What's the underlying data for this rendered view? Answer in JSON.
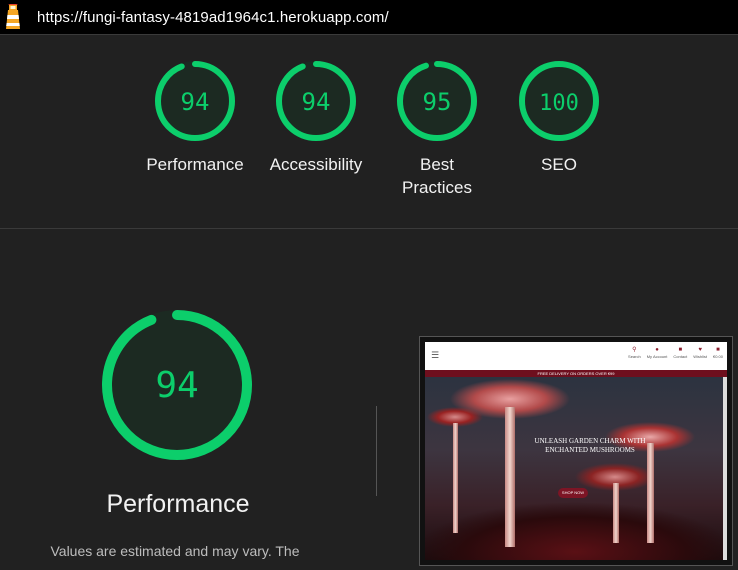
{
  "topbar": {
    "url": "https://fungi-fantasy-4819ad1964c1.herokuapp.com/",
    "logo_icon": "lighthouse-icon"
  },
  "categories": [
    {
      "score": 94,
      "label_lines": [
        "Performance"
      ]
    },
    {
      "score": 94,
      "label_lines": [
        "Accessibility"
      ]
    },
    {
      "score": 95,
      "label_lines": [
        "Best",
        "Practices"
      ]
    },
    {
      "score": 100,
      "label_lines": [
        "SEO"
      ]
    }
  ],
  "main": {
    "score": 94,
    "title": "Performance",
    "note": "Values are estimated and may vary. The"
  },
  "thumbnail": {
    "nav_items": [
      "Search",
      "My Account",
      "Contact",
      "Wishlist",
      "€0.00"
    ],
    "banner": "FREE DELIVERY ON ORDERS OVER €99",
    "hero_title": "UNLEASH GARDEN CHARM WITH ENCHANTED MUSHROOMS",
    "shop_button": "SHOP NOW"
  },
  "colors": {
    "pass": "#0cce6b",
    "gauge_bg": "#1c2a22",
    "background": "#212121"
  }
}
